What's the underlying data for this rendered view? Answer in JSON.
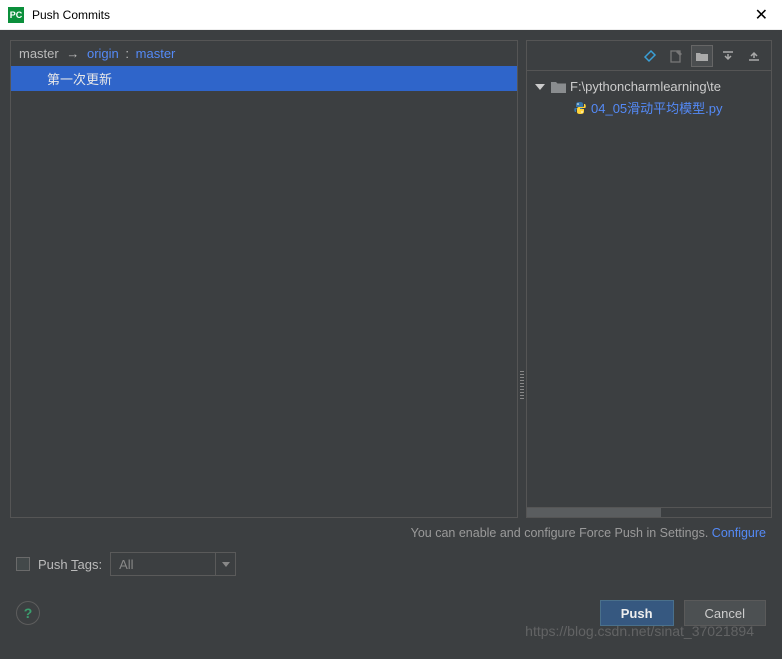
{
  "window": {
    "title": "Push Commits"
  },
  "branch": {
    "local": "master",
    "arrow": "→",
    "remote": "origin",
    "colon": ":",
    "tracking": "master"
  },
  "commits": [
    {
      "message": "第一次更新"
    }
  ],
  "toolbar_icons": {
    "pin": "pin-icon",
    "edit": "edit-icon",
    "group": "group-by-icon",
    "expand": "expand-all-icon",
    "collapse": "collapse-all-icon"
  },
  "tree": {
    "root": {
      "path": "F:\\pythoncharmlearning\\te"
    },
    "files": [
      {
        "name": "04_05滑动平均模型.py"
      }
    ]
  },
  "hint": {
    "text": "You can enable and configure Force Push in Settings. ",
    "link": "Configure"
  },
  "tags": {
    "label_pre": "Push ",
    "label_key": "T",
    "label_post": "ags:",
    "placeholder": "All"
  },
  "buttons": {
    "push": "Push",
    "cancel": "Cancel",
    "help": "?"
  },
  "watermark": "https://blog.csdn.net/sinat_37021894"
}
